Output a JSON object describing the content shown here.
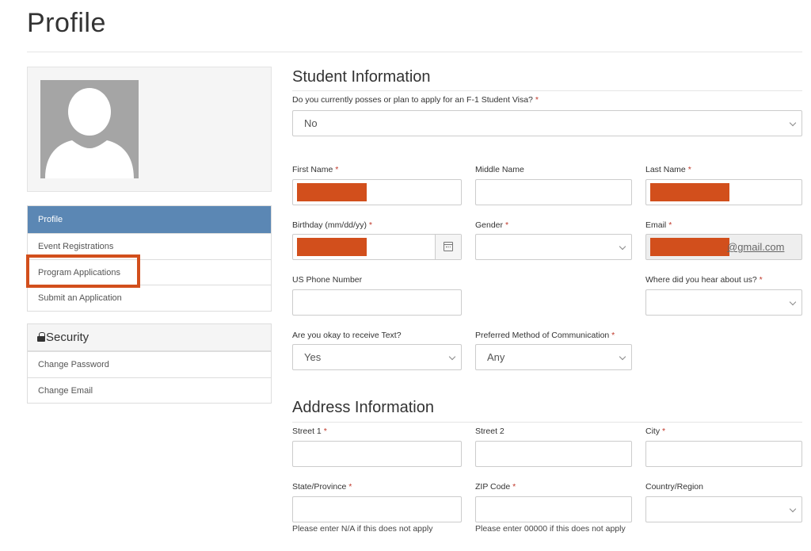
{
  "page": {
    "title": "Profile"
  },
  "sidebar": {
    "nav": [
      {
        "label": "Profile",
        "active": true
      },
      {
        "label": "Event Registrations",
        "active": false
      },
      {
        "label": "Program Applications",
        "active": false
      },
      {
        "label": "Submit an Application",
        "active": false
      }
    ],
    "security": {
      "title": "Security",
      "icon": "lock-icon",
      "items": [
        {
          "label": "Change Password"
        },
        {
          "label": "Change Email"
        }
      ]
    }
  },
  "student": {
    "title": "Student Information",
    "visa_label": "Do you currently posses or plan to apply for an F-1 Student Visa?",
    "visa_value": "No",
    "first_name_label": "First Name",
    "middle_name_label": "Middle Name",
    "last_name_label": "Last Name",
    "birthday_label": "Birthday (mm/dd/yy)",
    "gender_label": "Gender",
    "gender_value": "",
    "email_label": "Email",
    "email_suffix": "@gmail.com",
    "phone_label": "US Phone Number",
    "hear_label": "Where did you hear about us?",
    "text_label": "Are you okay to receive Text?",
    "text_value": "Yes",
    "comm_label": "Preferred Method of Communication",
    "comm_value": "Any"
  },
  "address": {
    "title": "Address Information",
    "street1_label": "Street 1",
    "street2_label": "Street 2",
    "city_label": "City",
    "state_label": "State/Province",
    "state_help": "Please enter N/A if this does not apply",
    "zip_label": "ZIP Code",
    "zip_help": "Please enter 00000 if this does not apply",
    "country_label": "Country/Region"
  },
  "colors": {
    "active_nav": "#5b87b4",
    "redaction": "#d24f1c",
    "highlight": "#d24f1c",
    "required": "#c0392b"
  }
}
